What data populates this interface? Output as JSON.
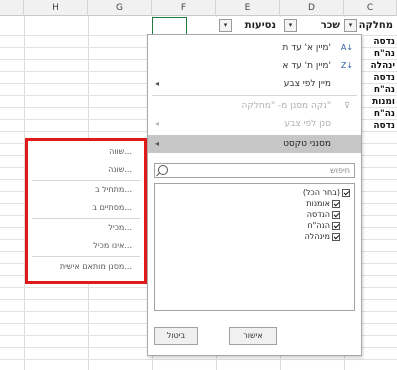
{
  "columns": {
    "H": "H",
    "G": "G",
    "F": "F",
    "E": "E",
    "D": "D",
    "C": "C"
  },
  "headers": {
    "absences": "נסיעות",
    "salary": "שכר",
    "department": "מחלקה"
  },
  "column_c_values": [
    "נדסה",
    "נה\"ח",
    "ינהלה",
    "נדסה",
    "נה\"ח",
    "ומנות",
    "נה\"ח",
    "נדסה"
  ],
  "dropdown": {
    "sort_asc": "מיין א' עד ת'",
    "sort_desc": "מיין ת' עד א'",
    "sort_by_color": "מיין לפי צבע",
    "clear_filter": "נקה מסנן מ- \"מחלקה\"",
    "filter_by_color": "סנן לפי צבע",
    "text_filters": "מסנני טקסט",
    "search_placeholder": "חיפוש",
    "select_all": "(בחר הכל)",
    "options": [
      "אומנות",
      "הנדסה",
      "הנה\"ח",
      "מינהלה"
    ],
    "ok": "אישור",
    "cancel": "ביטול"
  },
  "text_filter_submenu": {
    "items": [
      "שווה...",
      "שונה...",
      "מתחיל ב...",
      "מסתיים ב...",
      "מכיל...",
      "אינו מכיל...",
      "מסנן מותאם אישית..."
    ]
  },
  "colors": {
    "highlight_border": "#e01919",
    "hover_bg": "#c6c6c6",
    "selected_cell_border": "#1f7a3a"
  }
}
